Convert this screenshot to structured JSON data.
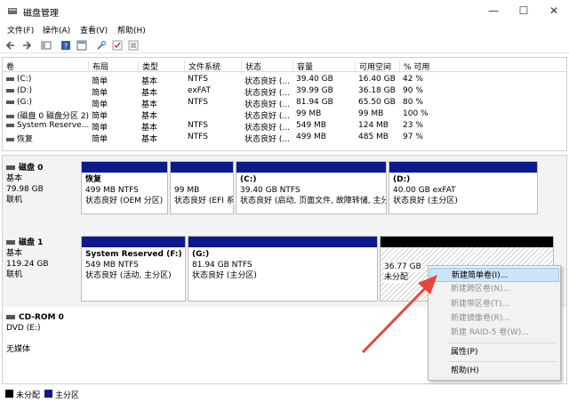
{
  "window": {
    "title": "磁盘管理",
    "minimize": "—",
    "maximize": "☐",
    "close": "✕"
  },
  "menu": [
    "文件(F)",
    "操作(A)",
    "查看(V)",
    "帮助(H)"
  ],
  "toolbar_icons": [
    "back-icon",
    "forward-icon",
    "list-icon",
    "help-icon",
    "properties-icon",
    "key-icon",
    "check-icon",
    "tasks-icon"
  ],
  "volume_table": {
    "headers": [
      "卷",
      "布局",
      "类型",
      "文件系统",
      "状态",
      "容量",
      "可用空间",
      "% 可用"
    ],
    "rows": [
      [
        "(C:)",
        "简单",
        "基本",
        "NTFS",
        "状态良好 (...",
        "39.40 GB",
        "16.40 GB",
        "42 %"
      ],
      [
        "(D:)",
        "简单",
        "基本",
        "exFAT",
        "状态良好 (...",
        "39.99 GB",
        "36.18 GB",
        "90 %"
      ],
      [
        "(G:)",
        "简单",
        "基本",
        "NTFS",
        "状态良好 (...",
        "81.94 GB",
        "65.50 GB",
        "80 %"
      ],
      [
        "(磁盘 0 磁盘分区 2)",
        "简单",
        "基本",
        "",
        "状态良好 (...",
        "99 MB",
        "99 MB",
        "100 %"
      ],
      [
        "System Reserve...",
        "简单",
        "基本",
        "NTFS",
        "状态良好 (...",
        "549 MB",
        "124 MB",
        "23 %"
      ],
      [
        "恢复",
        "简单",
        "基本",
        "NTFS",
        "状态良好 (...",
        "499 MB",
        "485 MB",
        "97 %"
      ]
    ]
  },
  "disks": [
    {
      "name": "磁盘 0",
      "type": "基本",
      "size": "79.98 GB",
      "status": "联机",
      "partitions": [
        {
          "title": "恢复",
          "line1": "499 MB NTFS",
          "line2": "状态良好 (OEM 分区)"
        },
        {
          "title": "",
          "line1": "99 MB",
          "line2": "状态良好 (EFI 系"
        },
        {
          "title": "(C:)",
          "line1": "39.40 GB NTFS",
          "line2": "状态良好 (启动, 页面文件, 故障转储, 主分"
        },
        {
          "title": "(D:)",
          "line1": "40.00 GB exFAT",
          "line2": "状态良好 (主分区)"
        }
      ]
    },
    {
      "name": "磁盘 1",
      "type": "基本",
      "size": "119.24 GB",
      "status": "联机",
      "partitions": [
        {
          "title": "System Reserved  (F:)",
          "line1": "549 MB NTFS",
          "line2": "状态良好 (活动, 主分区)"
        },
        {
          "title": "(G:)",
          "line1": "81.94 GB NTFS",
          "line2": "状态良好 (主分区)"
        },
        {
          "title": "",
          "line1": "36.77 GB",
          "line2": "未分配"
        }
      ]
    },
    {
      "name": "CD-ROM 0",
      "type": "DVD (E:)",
      "size": "",
      "status": "无媒体"
    }
  ],
  "legend": [
    {
      "label": "未分配",
      "color": "#000000"
    },
    {
      "label": "主分区",
      "color": "#0c1a8e"
    }
  ],
  "context_menu": {
    "items": [
      {
        "label": "新建简单卷(I)...",
        "enabled": true,
        "highlighted": true
      },
      {
        "label": "新建跨区卷(N)...",
        "enabled": false
      },
      {
        "label": "新建带区卷(T)...",
        "enabled": false
      },
      {
        "label": "新建镜像卷(R)...",
        "enabled": false
      },
      {
        "label": "新建 RAID-5 卷(W)...",
        "enabled": false
      },
      {
        "label": "属性(P)",
        "enabled": true
      },
      {
        "label": "帮助(H)",
        "enabled": true
      }
    ]
  },
  "colors": {
    "primary_partition": "#0c1a8e",
    "unallocated": "#000000",
    "annotation_arrow": "#e8463a",
    "menu_highlight": "#cce4f7"
  }
}
